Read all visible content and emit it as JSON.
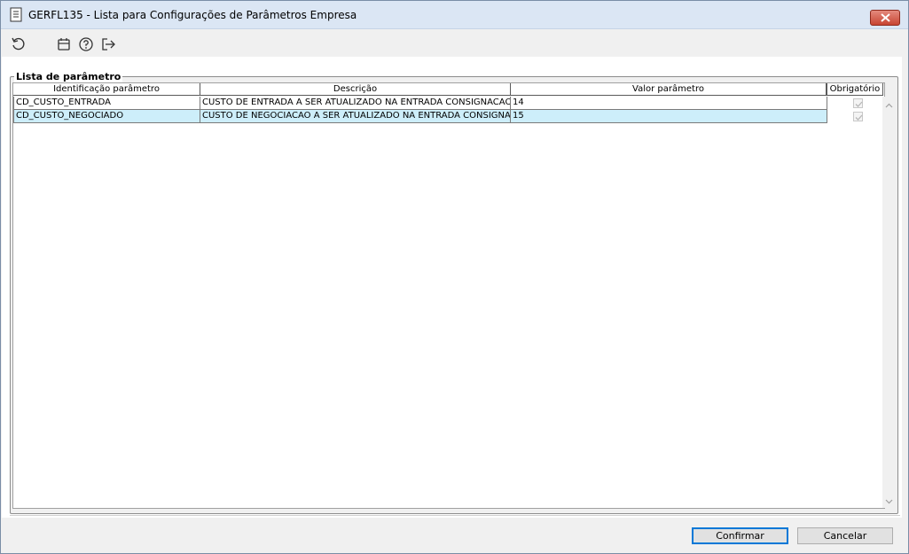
{
  "window": {
    "title": "GERFL135 - Lista para Configurações de Parâmetros Empresa"
  },
  "toolbar": {
    "icons": [
      "refresh-icon",
      "calendar-icon",
      "help-icon",
      "exit-icon"
    ]
  },
  "group": {
    "label": "Lista de parâmetro"
  },
  "table": {
    "columns": [
      "Identificação parâmetro",
      "Descrição",
      "Valor parâmetro",
      "Obrigatório"
    ],
    "rows": [
      {
        "id": "CD_CUSTO_ENTRADA",
        "descricao": "CUSTO DE ENTRADA A SER ATUALIZADO NA ENTRADA CONSIGNACAO",
        "valor": "14",
        "obrigatorio": true
      },
      {
        "id": "CD_CUSTO_NEGOCIADO",
        "descricao": "CUSTO DE NEGOCIACAO A SER ATUALIZADO NA ENTRADA CONSIGNACAO",
        "valor": "15",
        "obrigatorio": true
      }
    ],
    "selected_row": 1
  },
  "buttons": {
    "confirm": "Confirmar",
    "cancel": "Cancelar"
  },
  "colors": {
    "selection": "#cdeefa",
    "titlebar": "#dbe6f4",
    "close": "#c84532"
  }
}
